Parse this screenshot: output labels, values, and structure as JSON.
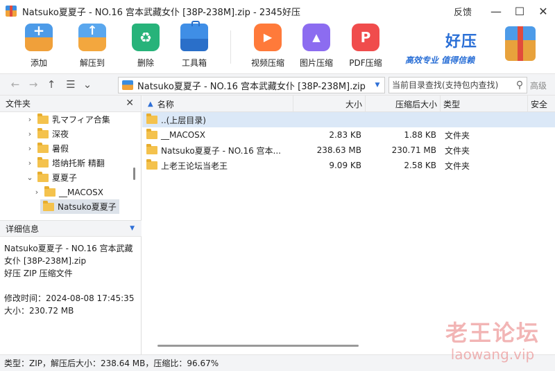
{
  "window": {
    "title": "Natsuko夏夏子 - NO.16 宫本武藏女仆 [38P-238M].zip - 2345好压",
    "feedback": "反馈",
    "min": "—",
    "max": "☐",
    "close": "✕"
  },
  "toolbar": {
    "add": "添加",
    "extract": "解压到",
    "delete": "删除",
    "tools": "工具箱",
    "video": "视频压缩",
    "image": "图片压缩",
    "pdf": "PDF压缩"
  },
  "brand": {
    "name": "好压",
    "slogan": "高效专业 值得信赖"
  },
  "nav": {
    "back": "←",
    "forward": "→",
    "up": "↑",
    "view": "☰",
    "view_drop": "⌄"
  },
  "address": {
    "path": "Natsuko夏夏子 - NO.16 宫本武藏女仆 [38P-238M].zip"
  },
  "search": {
    "placeholder": "当前目录查找(支持包内查找)",
    "advanced": "高级"
  },
  "folder_pane": {
    "title": "文件夹",
    "close": "✕",
    "tree": [
      {
        "label": "乳マフィア合集",
        "chev": "›"
      },
      {
        "label": "深夜",
        "chev": "›"
      },
      {
        "label": "暑假",
        "chev": "›"
      },
      {
        "label": "塔纳托斯 精翻",
        "chev": "›"
      },
      {
        "label": "夏夏子",
        "chev": "⌄"
      },
      {
        "label": "__MACOSX",
        "chev": "›"
      },
      {
        "label": "Natsuko夏夏子",
        "chev": ""
      }
    ]
  },
  "details": {
    "title": "详细信息",
    "file_name": "Natsuko夏夏子 - NO.16 宫本武藏女仆 [38P-238M].zip",
    "file_type": "好压 ZIP 压缩文件",
    "modified": "修改时间：2024-08-08 17:45:35",
    "size": "大小：230.72 MB"
  },
  "columns": {
    "name": "名称",
    "size": "大小",
    "packed": "压缩后大小",
    "type": "类型",
    "security": "安全"
  },
  "rows": [
    {
      "name": "..(上层目录)",
      "size": "",
      "packed": "",
      "type": ""
    },
    {
      "name": "__MACOSX",
      "size": "2.83 KB",
      "packed": "1.88 KB",
      "type": "文件夹"
    },
    {
      "name": "Natsuko夏夏子 - NO.16 宫本...",
      "size": "238.63 MB",
      "packed": "230.71 MB",
      "type": "文件夹"
    },
    {
      "name": "上老王论坛当老王",
      "size": "9.09 KB",
      "packed": "2.58 KB",
      "type": "文件夹"
    }
  ],
  "status": {
    "text": "类型：ZIP，解压后大小：238.64 MB，压缩比：96.67%"
  },
  "watermark": {
    "cn": "老王论坛",
    "en": "laowang.vip"
  }
}
